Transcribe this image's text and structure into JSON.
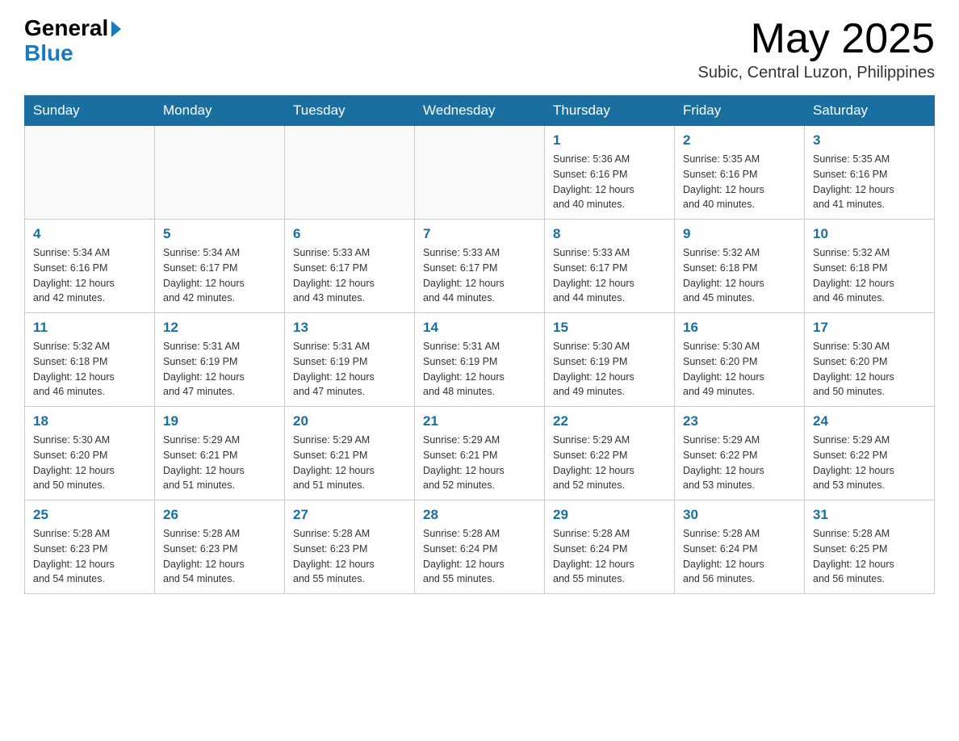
{
  "header": {
    "logo_general": "General",
    "logo_blue": "Blue",
    "month_year": "May 2025",
    "location": "Subic, Central Luzon, Philippines"
  },
  "weekdays": [
    "Sunday",
    "Monday",
    "Tuesday",
    "Wednesday",
    "Thursday",
    "Friday",
    "Saturday"
  ],
  "weeks": [
    {
      "days": [
        {
          "num": "",
          "info": ""
        },
        {
          "num": "",
          "info": ""
        },
        {
          "num": "",
          "info": ""
        },
        {
          "num": "",
          "info": ""
        },
        {
          "num": "1",
          "info": "Sunrise: 5:36 AM\nSunset: 6:16 PM\nDaylight: 12 hours\nand 40 minutes."
        },
        {
          "num": "2",
          "info": "Sunrise: 5:35 AM\nSunset: 6:16 PM\nDaylight: 12 hours\nand 40 minutes."
        },
        {
          "num": "3",
          "info": "Sunrise: 5:35 AM\nSunset: 6:16 PM\nDaylight: 12 hours\nand 41 minutes."
        }
      ]
    },
    {
      "days": [
        {
          "num": "4",
          "info": "Sunrise: 5:34 AM\nSunset: 6:16 PM\nDaylight: 12 hours\nand 42 minutes."
        },
        {
          "num": "5",
          "info": "Sunrise: 5:34 AM\nSunset: 6:17 PM\nDaylight: 12 hours\nand 42 minutes."
        },
        {
          "num": "6",
          "info": "Sunrise: 5:33 AM\nSunset: 6:17 PM\nDaylight: 12 hours\nand 43 minutes."
        },
        {
          "num": "7",
          "info": "Sunrise: 5:33 AM\nSunset: 6:17 PM\nDaylight: 12 hours\nand 44 minutes."
        },
        {
          "num": "8",
          "info": "Sunrise: 5:33 AM\nSunset: 6:17 PM\nDaylight: 12 hours\nand 44 minutes."
        },
        {
          "num": "9",
          "info": "Sunrise: 5:32 AM\nSunset: 6:18 PM\nDaylight: 12 hours\nand 45 minutes."
        },
        {
          "num": "10",
          "info": "Sunrise: 5:32 AM\nSunset: 6:18 PM\nDaylight: 12 hours\nand 46 minutes."
        }
      ]
    },
    {
      "days": [
        {
          "num": "11",
          "info": "Sunrise: 5:32 AM\nSunset: 6:18 PM\nDaylight: 12 hours\nand 46 minutes."
        },
        {
          "num": "12",
          "info": "Sunrise: 5:31 AM\nSunset: 6:19 PM\nDaylight: 12 hours\nand 47 minutes."
        },
        {
          "num": "13",
          "info": "Sunrise: 5:31 AM\nSunset: 6:19 PM\nDaylight: 12 hours\nand 47 minutes."
        },
        {
          "num": "14",
          "info": "Sunrise: 5:31 AM\nSunset: 6:19 PM\nDaylight: 12 hours\nand 48 minutes."
        },
        {
          "num": "15",
          "info": "Sunrise: 5:30 AM\nSunset: 6:19 PM\nDaylight: 12 hours\nand 49 minutes."
        },
        {
          "num": "16",
          "info": "Sunrise: 5:30 AM\nSunset: 6:20 PM\nDaylight: 12 hours\nand 49 minutes."
        },
        {
          "num": "17",
          "info": "Sunrise: 5:30 AM\nSunset: 6:20 PM\nDaylight: 12 hours\nand 50 minutes."
        }
      ]
    },
    {
      "days": [
        {
          "num": "18",
          "info": "Sunrise: 5:30 AM\nSunset: 6:20 PM\nDaylight: 12 hours\nand 50 minutes."
        },
        {
          "num": "19",
          "info": "Sunrise: 5:29 AM\nSunset: 6:21 PM\nDaylight: 12 hours\nand 51 minutes."
        },
        {
          "num": "20",
          "info": "Sunrise: 5:29 AM\nSunset: 6:21 PM\nDaylight: 12 hours\nand 51 minutes."
        },
        {
          "num": "21",
          "info": "Sunrise: 5:29 AM\nSunset: 6:21 PM\nDaylight: 12 hours\nand 52 minutes."
        },
        {
          "num": "22",
          "info": "Sunrise: 5:29 AM\nSunset: 6:22 PM\nDaylight: 12 hours\nand 52 minutes."
        },
        {
          "num": "23",
          "info": "Sunrise: 5:29 AM\nSunset: 6:22 PM\nDaylight: 12 hours\nand 53 minutes."
        },
        {
          "num": "24",
          "info": "Sunrise: 5:29 AM\nSunset: 6:22 PM\nDaylight: 12 hours\nand 53 minutes."
        }
      ]
    },
    {
      "days": [
        {
          "num": "25",
          "info": "Sunrise: 5:28 AM\nSunset: 6:23 PM\nDaylight: 12 hours\nand 54 minutes."
        },
        {
          "num": "26",
          "info": "Sunrise: 5:28 AM\nSunset: 6:23 PM\nDaylight: 12 hours\nand 54 minutes."
        },
        {
          "num": "27",
          "info": "Sunrise: 5:28 AM\nSunset: 6:23 PM\nDaylight: 12 hours\nand 55 minutes."
        },
        {
          "num": "28",
          "info": "Sunrise: 5:28 AM\nSunset: 6:24 PM\nDaylight: 12 hours\nand 55 minutes."
        },
        {
          "num": "29",
          "info": "Sunrise: 5:28 AM\nSunset: 6:24 PM\nDaylight: 12 hours\nand 55 minutes."
        },
        {
          "num": "30",
          "info": "Sunrise: 5:28 AM\nSunset: 6:24 PM\nDaylight: 12 hours\nand 56 minutes."
        },
        {
          "num": "31",
          "info": "Sunrise: 5:28 AM\nSunset: 6:25 PM\nDaylight: 12 hours\nand 56 minutes."
        }
      ]
    }
  ]
}
